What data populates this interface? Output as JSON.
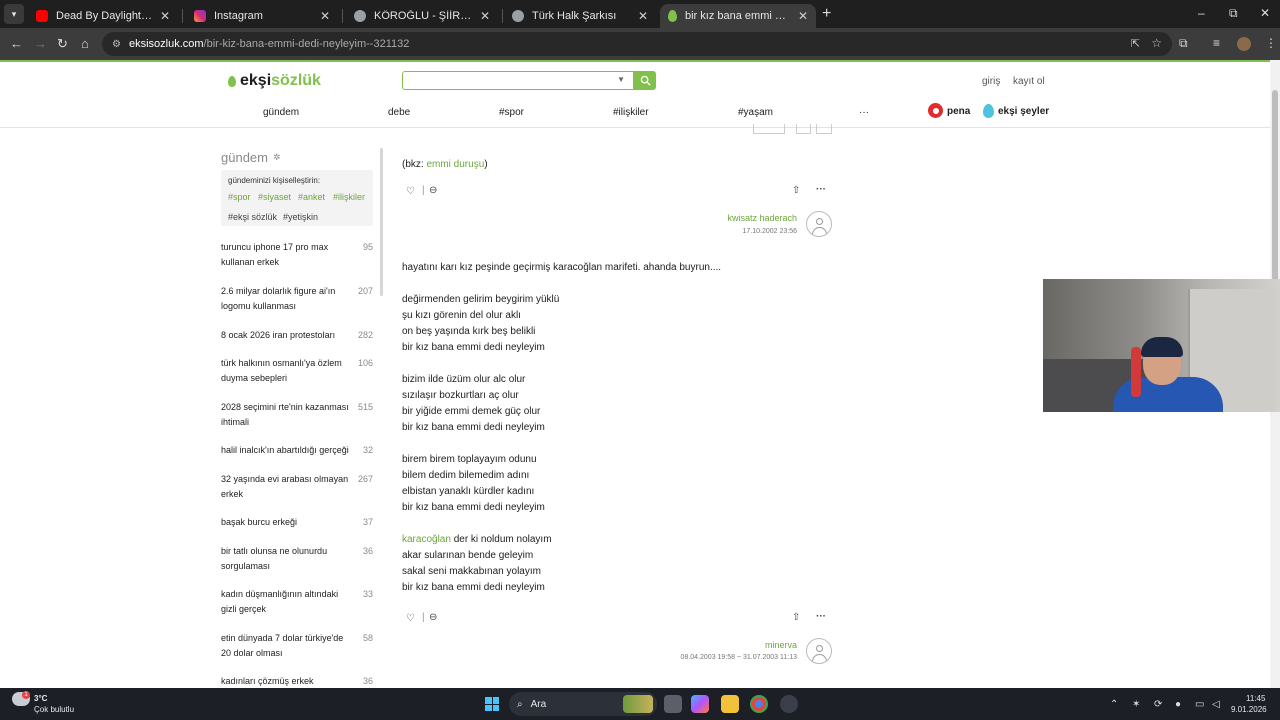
{
  "browser": {
    "tabs": [
      {
        "title": "Dead By Daylight Michael Myers",
        "favicon": "youtube-icon",
        "color": "#ff0000",
        "active": false
      },
      {
        "title": "Instagram",
        "favicon": "instagram-icon",
        "color": "#d62976",
        "active": false
      },
      {
        "title": "KÖROĞLU - ŞİİR PARKI",
        "favicon": "globe-icon",
        "color": "#9aa0a6",
        "active": false
      },
      {
        "title": "Türk Halk Şarkısı",
        "favicon": "globe-icon",
        "color": "#9aa0a6",
        "active": false
      },
      {
        "title": "bir kız bana emmi dedi neyleyim",
        "favicon": "eksi-drop-icon",
        "color": "#81c14b",
        "active": true
      }
    ],
    "url_host": "eksisozluk.com",
    "url_path": "/bir-kiz-bana-emmi-dedi-neyleyim--321132",
    "new_tab": "+",
    "win_min": "–",
    "win_max": "⧉",
    "win_close": "✕"
  },
  "site": {
    "logo_main": "ekşi",
    "logo_accent": "sözlük",
    "search_placeholder": "",
    "login": "giriş",
    "register": "kayıt ol",
    "nav": [
      "gündem",
      "debe",
      "#spor",
      "#ilişkiler",
      "#yaşam",
      "···"
    ],
    "pena": "pena",
    "eksi_seyler": "ekşi şeyler",
    "accent": "#81c14b"
  },
  "sidebar": {
    "title": "gündem",
    "hint": "gündeminizi kişiselleştirin:",
    "tags": [
      "#spor",
      "#siyaset",
      "#anket",
      "#ilişkiler",
      "#ekşi sözlük",
      "#yetişkin"
    ],
    "topics": [
      {
        "title": "turuncu iphone 17 pro max kullanan erkek",
        "count": "95"
      },
      {
        "title": "2.6 milyar dolarlık figure ai'ın logomu kullanması",
        "count": "207"
      },
      {
        "title": "8 ocak 2026 iran protestoları",
        "count": "282"
      },
      {
        "title": "türk halkının osmanlı'ya özlem duyma sebepleri",
        "count": "106"
      },
      {
        "title": "2028 seçimini rte'nin kazanması ihtimali",
        "count": "515"
      },
      {
        "title": "halil inalcık'ın abartıldığı gerçeği",
        "count": "32"
      },
      {
        "title": "32 yaşında evi arabası olmayan erkek",
        "count": "267"
      },
      {
        "title": "başak burcu erkeği",
        "count": "37"
      },
      {
        "title": "bir tatlı olunsa ne olunurdu sorgulaması",
        "count": "36"
      },
      {
        "title": "kadın düşmanlığının altındaki gizli gerçek",
        "count": "33"
      },
      {
        "title": "etin dünyada 7 dolar türkiye'de 20 dolar olması",
        "count": "58"
      },
      {
        "title": "kadınları çözmüş erkek",
        "count": "36"
      }
    ]
  },
  "entry1": {
    "text_prefix": "(bkz: ",
    "link": "emmi duruşu",
    "text_suffix": ")",
    "author": "kwisatz haderach",
    "date": "17.10.2002 23:56"
  },
  "entry2": {
    "lines": [
      "hayatını karı kız peşinde geçirmiş karacoğlan marifeti. ahanda buyrun....",
      "",
      "değirmenden gelirim beygirim yüklü",
      "şu kızı görenin del olur aklı",
      "on beş yaşında kırk beş belikli",
      "bir kız bana emmi dedi neyleyim",
      "",
      "bizim ilde üzüm olur alc olur",
      "sızılaşır bozkurtları aç olur",
      "bir yiğide emmi demek güç olur",
      "bir kız bana emmi dedi neyleyim",
      "",
      "birem birem toplayayım odunu",
      "bilem dedim bilemedim adını",
      "elbistan yanaklı kürdler kadını",
      "bir kız bana emmi dedi neyleyim"
    ],
    "link_word": "karacoğlan",
    "last_stanza_first_rest": " der ki noldum nolayım",
    "last_stanza": [
      "akar sularınan bende geleyim",
      "sakal seni makkabınan yolayım",
      "bir kız bana emmi dedi neyleyim"
    ],
    "author": "minerva",
    "date": "08.04.2003 19:58 ~ 31.07.2003 11:13"
  },
  "taskbar": {
    "temp": "3°C",
    "weather": "Çok bulutlu",
    "weather_badge": "1",
    "search": "Ara",
    "time": "11:45",
    "date": "9.01.2026"
  }
}
